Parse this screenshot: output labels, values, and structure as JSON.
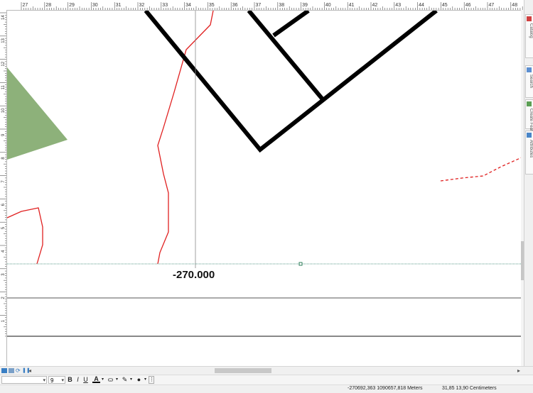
{
  "rulers": {
    "top_ticks": [
      "27",
      "28",
      "29",
      "30",
      "31",
      "32",
      "33",
      "34",
      "35",
      "36",
      "37",
      "38",
      "39",
      "40",
      "41",
      "42",
      "43",
      "44",
      "45",
      "46",
      "47",
      "48"
    ],
    "left_ticks": [
      "14",
      "13",
      "12",
      "11",
      "10",
      "9",
      "8",
      "7",
      "6",
      "5",
      "4",
      "3",
      "2",
      "1"
    ]
  },
  "map": {
    "elevation_label": "-270.000",
    "colors": {
      "polygon_fill": "#8db17a",
      "red_line": "#e02020",
      "black_line": "#000000",
      "guide": "#5a9a8a"
    }
  },
  "toolbar": {
    "font_name": "",
    "font_size": "9",
    "bold_label": "B",
    "italic_label": "I",
    "underline_label": "U",
    "font_color_label": "A"
  },
  "status": {
    "map_coords": "-270692,363  1090657,818 Meters",
    "page_coords": "31,85  13,90 Centimeters"
  },
  "side_panels": [
    "Catalog",
    "Search",
    "Create Features",
    "Attributes"
  ]
}
